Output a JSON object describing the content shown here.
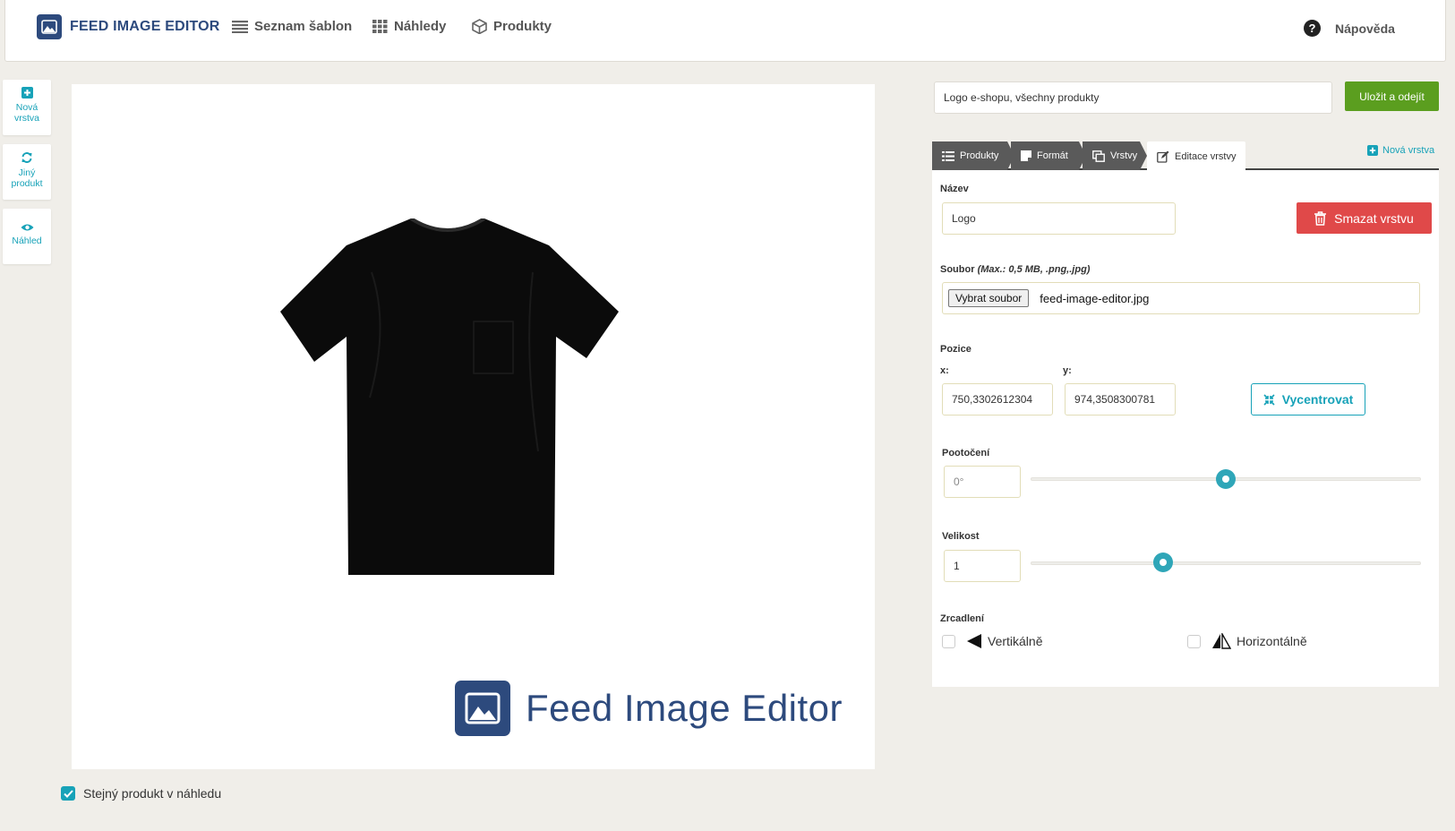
{
  "brand": {
    "title": "FEED IMAGE EDITOR",
    "color": "#2d4a7d"
  },
  "nav": [
    {
      "label": "Seznam šablon",
      "icon": "list-icon"
    },
    {
      "label": "Náhledy",
      "icon": "grid-icon"
    },
    {
      "label": "Produkty",
      "icon": "box-icon"
    }
  ],
  "help": {
    "label": "Nápověda",
    "icon": "question-icon"
  },
  "tools": [
    {
      "label": "Nová vrstva",
      "icon": "plus-square-icon"
    },
    {
      "label": "Jiný produkt",
      "icon": "refresh-icon"
    },
    {
      "label": "Náhled",
      "icon": "eye-icon"
    }
  ],
  "canvas": {
    "overlay_text": "Feed Image Editor",
    "product_image": "black-tshirt"
  },
  "same_product": {
    "label": "Stejný produkt v náhledu",
    "checked": true
  },
  "template_name": {
    "value": "Logo e-shopu, všechny produkty"
  },
  "save_button": {
    "label": "Uložit a odejít",
    "color": "#5b9e1f"
  },
  "tabs": [
    {
      "label": "Produkty",
      "icon": "list-icon",
      "active": false
    },
    {
      "label": "Formát",
      "icon": "note-icon",
      "active": false
    },
    {
      "label": "Vrstvy",
      "icon": "layers-icon",
      "active": false
    },
    {
      "label": "Editace vrstvy",
      "icon": "edit-icon",
      "active": true
    }
  ],
  "new_layer_link": {
    "label": "Nová vrstva"
  },
  "layer": {
    "name_label": "Název",
    "name_value": "Logo",
    "delete_label": "Smazat vrstvu",
    "file_label": "Soubor",
    "file_hint": "(Max.: 0,5 MB, .png,.jpg)",
    "file_button": "Vybrat soubor",
    "file_name": "feed-image-editor.jpg",
    "position_label": "Pozice",
    "x_label": "x:",
    "x_value": "750,3302612304",
    "y_label": "y:",
    "y_value": "974,3508300781",
    "center_label": "Vycentrovat",
    "rotation_label": "Pootočení",
    "rotation_value": "0°",
    "rotation_slider": 0.5,
    "size_label": "Velikost",
    "size_value": "1",
    "size_slider": 0.34,
    "mirror_label": "Zrcadlení",
    "mirror_vertical": "Vertikálně",
    "mirror_horizontal": "Horizontálně"
  },
  "colors": {
    "accent": "#17a2b8",
    "danger": "#e04949",
    "tab_bg": "#5a5a5a"
  }
}
